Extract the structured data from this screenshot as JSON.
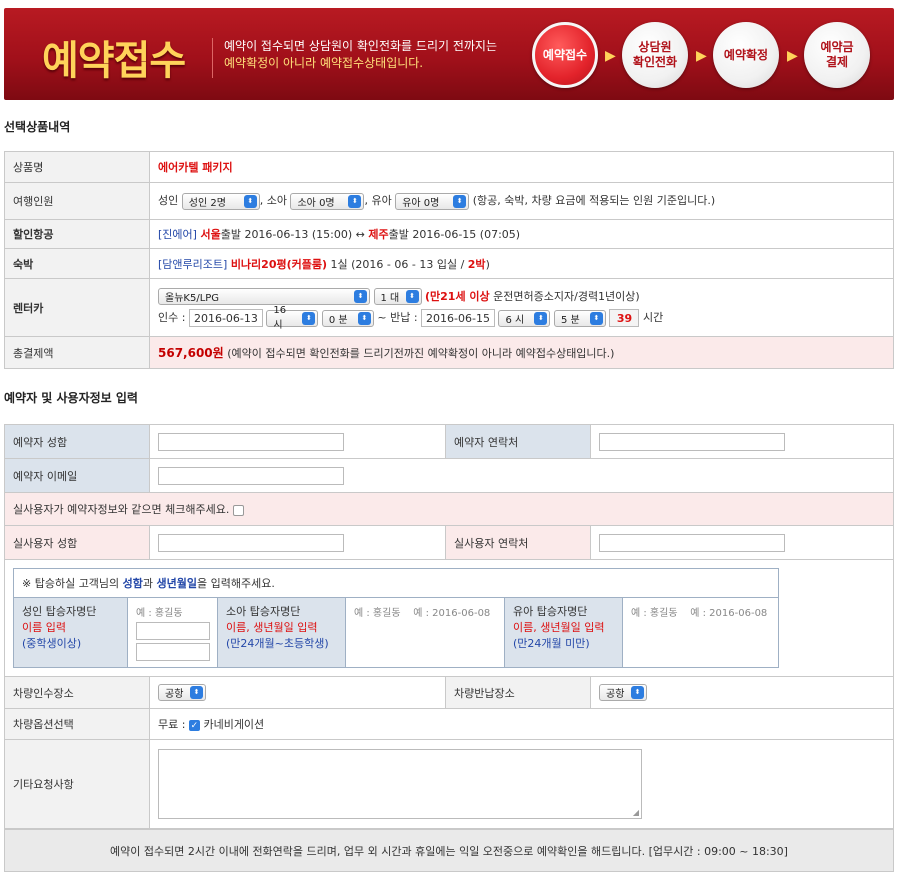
{
  "banner": {
    "title": "예약접수",
    "desc_line1": "예약이 접수되면 상담원이 확인전화를 드리기 전까지는",
    "desc_line2": "예약확정이 아니라 예약접수상태입니다.",
    "steps": [
      "예약접수",
      "상담원\n확인전화",
      "예약확정",
      "예약금\n결제"
    ],
    "arrow": "▶"
  },
  "product": {
    "section_title": "선택상품내역",
    "name_label": "상품명",
    "name_value": "에어카텔 패키지",
    "travelers_label": "여행인원",
    "adult_label": "성인",
    "adult_value": "성인 2명",
    "child_label": ", 소아",
    "child_value": "소아 0명",
    "infant_label": ", 유아",
    "infant_value": "유아 0명",
    "travelers_note": "(항공, 숙박, 차량 요금에 적용되는 인원 기준입니다.)",
    "air_label": "할인항공",
    "air_airline": "[진에어]",
    "air_from_city": "서울",
    "air_from_text": "출발 2016-06-13 (15:00) ↔",
    "air_to_city": "제주",
    "air_to_text": "출발 2016-06-15 (07:05)",
    "hotel_label": "숙박",
    "hotel_name": "[담앤루리조트]",
    "hotel_room": "비나리20평(커플룸)",
    "hotel_info": "1실 (2016 - 06 - 13 입실 /",
    "hotel_nights": "2박",
    "hotel_close": ")",
    "car_label": "렌터카",
    "car_model": "올뉴K5/LPG",
    "car_count": "1 대",
    "car_note_red": "(만21세 이상",
    "car_note": "운전면허증소지자/경력1년이상)",
    "pickup_label": "인수 :",
    "pickup_date": "2016-06-13",
    "pickup_hour": "16 시",
    "pickup_min": "0 분",
    "return_label": "~ 반납 :",
    "return_date": "2016-06-15",
    "return_hour": "6 시",
    "return_min": "5 분",
    "rental_hours": "39",
    "hours_unit": "시간",
    "total_label": "총결제액",
    "total_value": "567,600원",
    "total_note": "(예약이 접수되면 확인전화를 드리기전까진 예약확정이 아니라 예약접수상태입니다.)"
  },
  "booker": {
    "section_title": "예약자 및 사용자정보 입력",
    "name_label": "예약자 성함",
    "phone_label": "예약자 연락처",
    "email_label": "예약자 이메일",
    "same_notice": "실사용자가 예약자정보와 같으면 체크해주세요.",
    "user_name_label": "실사용자 성함",
    "user_phone_label": "실사용자 연락처",
    "passenger_notice_pre": "※ 탑승하실 고객님의",
    "passenger_notice_name": "성함",
    "passenger_notice_mid": "과",
    "passenger_notice_birth": "생년월일",
    "passenger_notice_post": "을 입력해주세요.",
    "adult_group_title": "성인 탑승자명단",
    "adult_group_req": "이름 입력",
    "adult_group_note": "(중학생이상)",
    "adult_placeholder": "예 : 홍길동",
    "child_group_title": "소아 탑승자명단",
    "child_group_req": "이름, 생년월일 입력",
    "child_group_note": "(만24개월~초등학생)",
    "child_example_name": "예 : 홍길동",
    "child_example_birth": "예 : 2016-06-08",
    "infant_group_title": "유아 탑승자명단",
    "infant_group_req": "이름, 생년월일 입력",
    "infant_group_note": "(만24개월 미만)",
    "infant_example_name": "예 : 홍길동",
    "infant_example_birth": "예 : 2016-06-08",
    "pickup_place_label": "차량인수장소",
    "pickup_place_value": "공항",
    "return_place_label": "차량반납장소",
    "return_place_value": "공항",
    "car_option_label": "차량옵션선택",
    "car_option_free": "무료 :",
    "car_option_nav": "카네비게이션",
    "etc_label": "기타요청사항"
  },
  "footer": {
    "note": "예약이 접수되면 2시간 이내에 전화연락을 드리며, 업무 외 시간과 휴일에는 익일 오전중으로 예약확인을 해드립니다. [업무시간 : 09:00 ~ 18:30]"
  },
  "colors": {
    "banner_red": "#a1101a",
    "accent_red": "#d11111",
    "accent_blue": "#2347a8",
    "label_blue_bg": "#dbe3ec",
    "notice_pink_bg": "#fbeaea"
  }
}
